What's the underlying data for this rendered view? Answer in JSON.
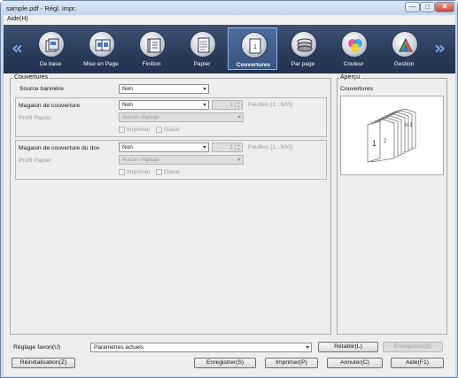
{
  "window": {
    "title": "sample.pdf - Régl. impr.",
    "min_glyph": "—",
    "max_glyph": "□",
    "close_glyph": "✕"
  },
  "menu": {
    "help": "Aide(H)"
  },
  "toolbar": {
    "prev_arrow": "«",
    "next_arrow": "»",
    "tabs": [
      {
        "label": "De base",
        "icon": "basic-icon",
        "active": false
      },
      {
        "label": "Mise en Page",
        "icon": "layout-icon",
        "active": false
      },
      {
        "label": "Finition",
        "icon": "finishing-icon",
        "active": false
      },
      {
        "label": "Papier",
        "icon": "paper-icon",
        "active": false
      },
      {
        "label": "Couvertures",
        "icon": "cover-icon",
        "active": true
      },
      {
        "label": "Par page",
        "icon": "per-page-icon",
        "active": false
      },
      {
        "label": "Couleur",
        "icon": "color-icon",
        "active": false
      },
      {
        "label": "Gestion",
        "icon": "management-icon",
        "active": false
      }
    ],
    "accent": "#2a3b5a"
  },
  "covers": {
    "group_title": "Couvertures",
    "banner_source": {
      "label": "Source bannière",
      "value": "Non"
    },
    "front": {
      "tray_label": "Magasin de couverture",
      "tray_value": "Non",
      "count_value": "1",
      "sheets_label": "Feuilles [1...500]",
      "profile_label": "Profil Papier",
      "profile_value": "Aucun réglage",
      "print_label": "Imprimer",
      "glossy_label": "Glacé"
    },
    "back": {
      "tray_label": "Magasin de couverture du dos",
      "tray_value": "Non",
      "count_value": "1",
      "sheets_label": "Feuilles [1...500]",
      "profile_label": "Profil Papier",
      "profile_value": "Aucun réglage",
      "print_label": "Imprimer",
      "glossy_label": "Glacé"
    }
  },
  "preview": {
    "group_title": "Aperçu",
    "caption": "Couvertures",
    "page_front": "1",
    "page_second": "2",
    "page_back": "n-1"
  },
  "footer": {
    "favorite_label": "Réglage favori(U)",
    "favorite_value": "Paramètres actuels",
    "restore": "Rétablir(L)",
    "save_favorite": "Enregistrer(B)",
    "reset": "Réinitialisation(Z)",
    "save": "Enregistrer(S)",
    "print": "Imprimer(P)",
    "cancel": "Annuler(C)",
    "help": "Aide(F1)"
  }
}
